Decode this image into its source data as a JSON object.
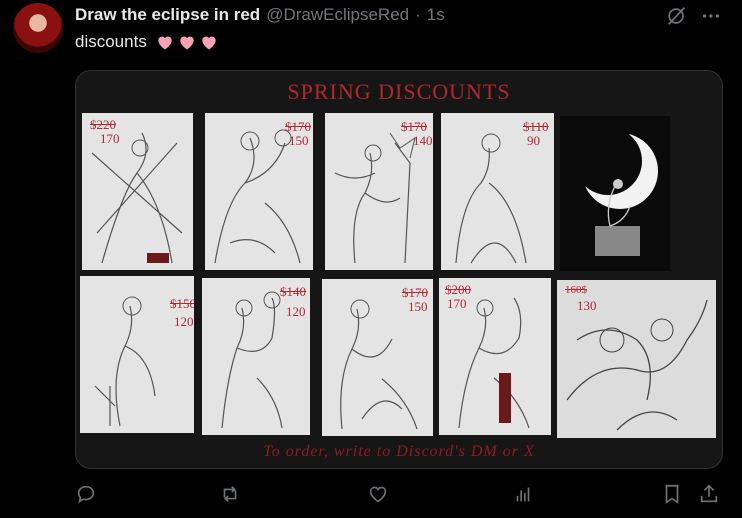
{
  "post": {
    "author_name": "Draw the eclipse in red",
    "handle": "@DrawEclipseRed",
    "separator": "·",
    "time": "1s",
    "text": "discounts",
    "hearts": [
      "pink-heart",
      "pink-heart",
      "pink-heart"
    ]
  },
  "image": {
    "title": "SPRING DISCOUNTS",
    "footer": "To order, write to Discord's DM or X",
    "tiles": [
      {
        "old": "$220",
        "new": "170"
      },
      {
        "old": "$170",
        "new": "150"
      },
      {
        "old": "$170",
        "new": "140"
      },
      {
        "old": "$110",
        "new": "90"
      },
      {
        "old": "",
        "new": ""
      },
      {
        "old": "$150",
        "new": "120"
      },
      {
        "old": "$140",
        "new": "120"
      },
      {
        "old": "$170",
        "new": "150"
      },
      {
        "old": "$200",
        "new": "170"
      },
      {
        "old": "160$",
        "new": "130"
      }
    ]
  },
  "icons": {
    "grok": "grok-icon",
    "more": "more-icon",
    "reply": "reply-icon",
    "repost": "repost-icon",
    "like": "heart-icon",
    "views": "views-icon",
    "bookmark": "bookmark-icon",
    "share": "share-icon"
  },
  "colors": {
    "accent_red": "#b3262e",
    "text_muted": "#71767b",
    "heart_pink": "#f7a3b5"
  }
}
